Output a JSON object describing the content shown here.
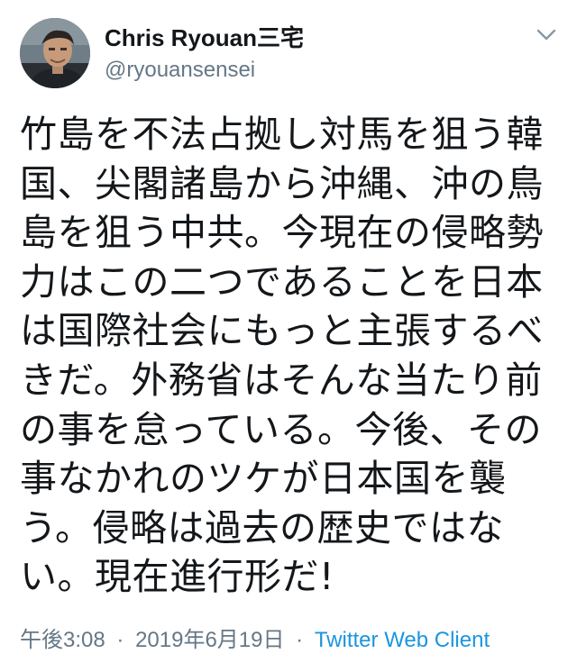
{
  "author": {
    "display_name": "Chris Ryouan三宅",
    "handle": "@ryouansensei"
  },
  "tweet": {
    "text": "竹島を不法占拠し対馬を狙う韓国、尖閣諸島から沖縄、沖の鳥島を狙う中共。今現在の侵略勢力はこの二つであることを日本は国際社会にもっと主張するべきだ。外務省はそんな当たり前の事を怠っている。今後、その事なかれのツケが日本国を襲う。侵略は過去の歴史ではない。現在進行形だ!"
  },
  "meta": {
    "time": "午後3:08",
    "separator": "·",
    "date": "2019年6月19日",
    "source": "Twitter Web Client"
  },
  "icons": {
    "avatar": "profile-photo",
    "caret": "chevron-down-icon"
  },
  "colors": {
    "text": "#14171a",
    "secondary": "#657786",
    "link": "#1b95e0"
  }
}
